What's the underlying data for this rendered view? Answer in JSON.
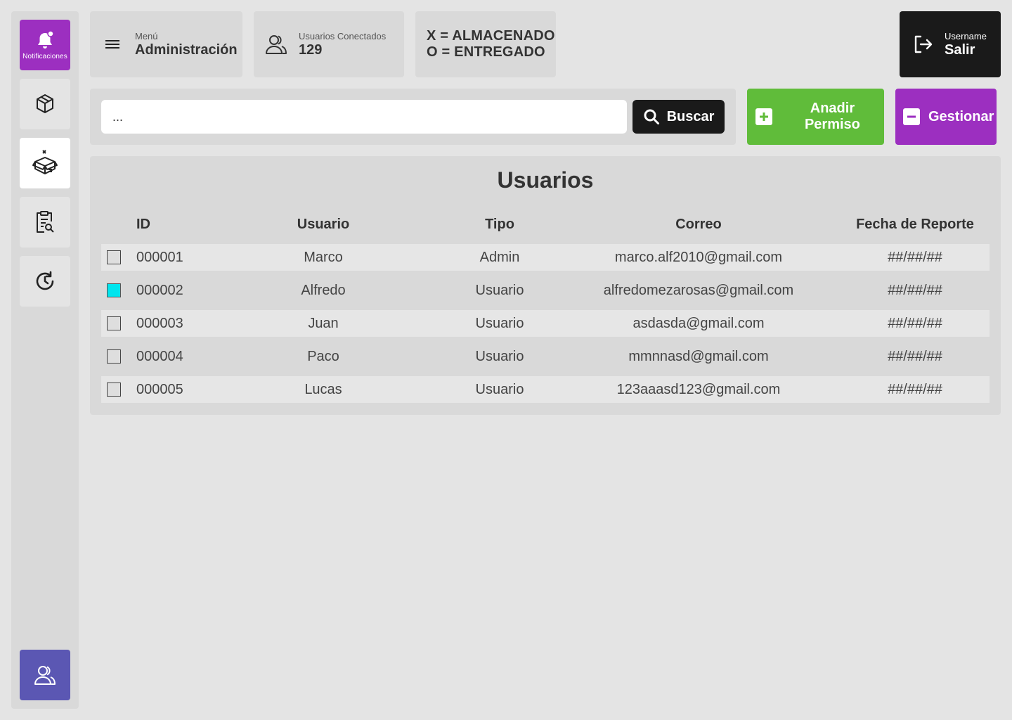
{
  "sidebar": {
    "notifications_label": "Notificaciones",
    "items": [
      {
        "icon": "box-icon"
      },
      {
        "icon": "open-box-icon"
      },
      {
        "icon": "clipboard-search-icon"
      },
      {
        "icon": "refresh-clock-icon"
      }
    ],
    "bottom_icon": "users-icon"
  },
  "header": {
    "menu_small": "Menú",
    "menu_title": "Administración",
    "connected_label": "Usuarios Conectados",
    "connected_count": "129",
    "legend_x": "X = ALMACENADO",
    "legend_o": "O = ENTREGADO",
    "username": "Username",
    "logout_label": "Salir"
  },
  "search": {
    "value": "...",
    "button_label": "Buscar"
  },
  "actions": {
    "add_label": "Anadir Permiso",
    "manage_label": "Gestionar"
  },
  "colors": {
    "notif": "#9c2fc0",
    "add": "#60bc3a",
    "manage": "#9c2fc0",
    "users_btn": "#5b57b3",
    "checked": "#00e5ee"
  },
  "table": {
    "title": "Usuarios",
    "columns": [
      "ID",
      "Usuario",
      "Tipo",
      "Correo",
      "Fecha de Reporte"
    ],
    "rows": [
      {
        "checked": false,
        "id": "000001",
        "usuario": "Marco",
        "tipo": "Admin",
        "correo": "marco.alf2010@gmail.com",
        "fecha": "##/##/##"
      },
      {
        "checked": true,
        "id": "000002",
        "usuario": "Alfredo",
        "tipo": "Usuario",
        "correo": "alfredomezarosas@gmail.com",
        "fecha": "##/##/##"
      },
      {
        "checked": false,
        "id": "000003",
        "usuario": "Juan",
        "tipo": "Usuario",
        "correo": "asdasda@gmail.com",
        "fecha": "##/##/##"
      },
      {
        "checked": false,
        "id": "000004",
        "usuario": "Paco",
        "tipo": "Usuario",
        "correo": "mmnnasd@gmail.com",
        "fecha": "##/##/##"
      },
      {
        "checked": false,
        "id": "000005",
        "usuario": "Lucas",
        "tipo": "Usuario",
        "correo": "123aaasd123@gmail.com",
        "fecha": "##/##/##"
      }
    ]
  }
}
